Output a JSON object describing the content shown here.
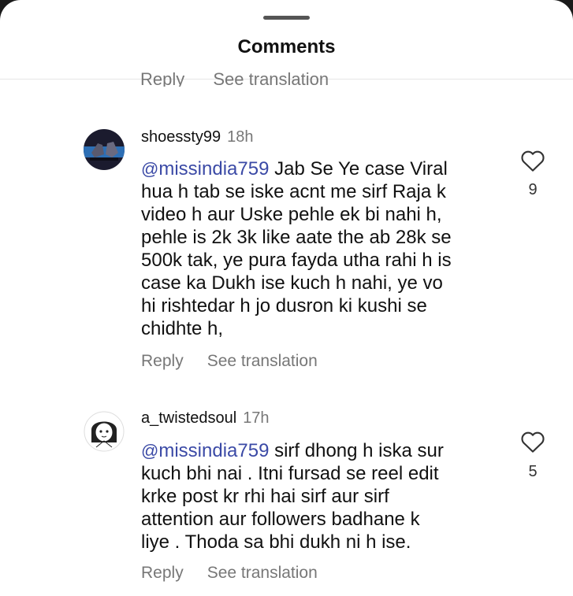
{
  "header": {
    "title": "Comments"
  },
  "previous_comment": {
    "reply_label": "Reply",
    "translate_label": "See translation"
  },
  "comments": [
    {
      "username": "shoessty99",
      "time": "18h",
      "mention": "@missindia759",
      "mention_icon": "threads-icon",
      "lines": [
        "Jab Se Ye case Viral",
        "hua h tab se iske acnt me sirf Raja k",
        "video h aur Uske pehle ek bi nahi h,",
        "pehle is 2k 3k like aate the ab 28k se",
        "500k tak, ye pura fayda utha rahi h is",
        "case ka Dukh ise kuch h nahi, ye vo",
        "hi rishtedar h jo dusron ki kushi se",
        "chidhte h,"
      ],
      "reply_label": "Reply",
      "translate_label": "See translation",
      "likes": "9"
    },
    {
      "username": "a_twistedsoul",
      "time": "17h",
      "mention": "@missindia759",
      "mention_icon": "threads-icon",
      "lines": [
        "sirf dhong h iska sur",
        "kuch bhi nai . Itni fursad se reel edit",
        "krke post kr rhi hai sirf aur sirf",
        "attention aur followers badhane k",
        "liye . Thoda sa bhi dukh ni h ise."
      ],
      "reply_label": "Reply",
      "translate_label": "See translation",
      "likes": "5"
    }
  ],
  "colors": {
    "mention": "#3b4aa6",
    "secondary_text": "#777777"
  }
}
